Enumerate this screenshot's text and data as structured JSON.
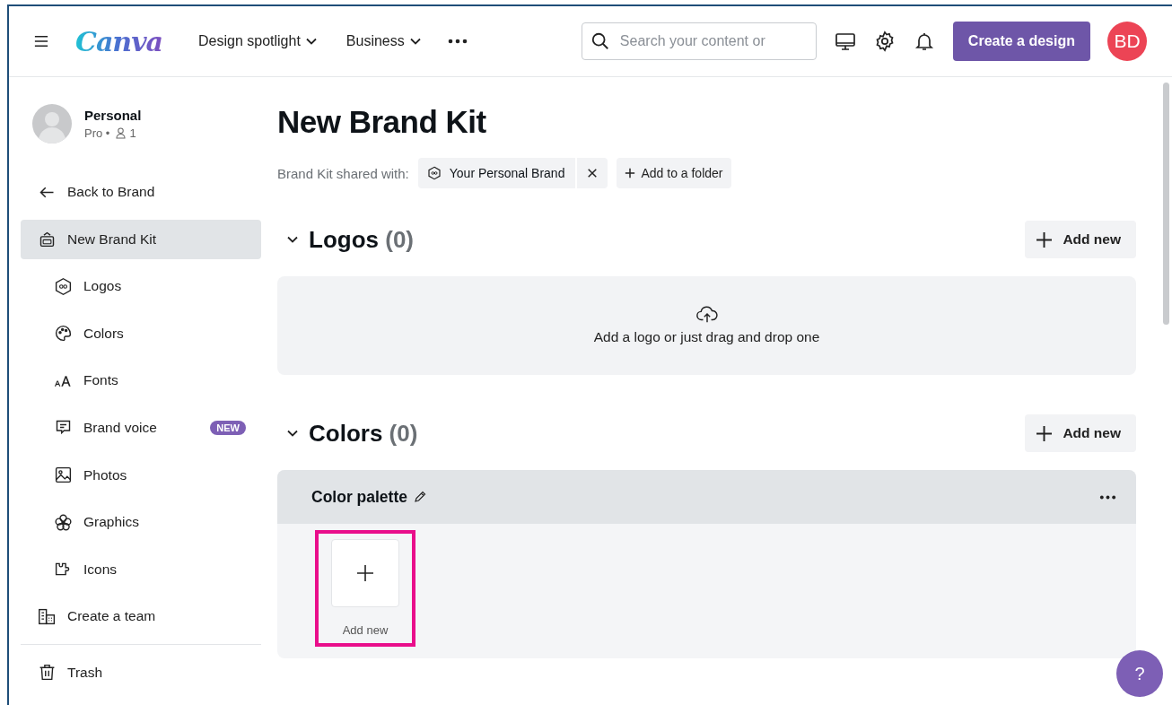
{
  "header": {
    "logo": "Canva",
    "nav": [
      {
        "label": "Design spotlight",
        "dropdown": true
      },
      {
        "label": "Business",
        "dropdown": true
      }
    ],
    "search": {
      "placeholder": "Search your content or"
    },
    "create_button": "Create a design",
    "avatar": "BD"
  },
  "sidebar": {
    "account": {
      "name": "Personal",
      "plan": "Pro •",
      "members": "1"
    },
    "back": "Back to Brand",
    "items": [
      {
        "label": "New Brand Kit",
        "kind": "kit",
        "selected": true,
        "children": [
          {
            "label": "Logos",
            "kind": "logo",
            "selected": false
          },
          {
            "label": "Colors",
            "kind": "palette",
            "selected": false
          },
          {
            "label": "Fonts",
            "kind": "fonts",
            "selected": false
          },
          {
            "label": "Brand voice",
            "kind": "voice",
            "selected": false,
            "badge": "NEW"
          },
          {
            "label": "Photos",
            "kind": "photo",
            "selected": false
          },
          {
            "label": "Graphics",
            "kind": "flower",
            "selected": false
          },
          {
            "label": "Icons",
            "kind": "puzzle",
            "selected": false
          }
        ]
      },
      {
        "label": "Create a team",
        "kind": "team",
        "selected": false
      }
    ],
    "footer_items": [
      {
        "label": "Trash",
        "kind": "trash",
        "selected": false
      }
    ]
  },
  "main": {
    "title": "New Brand Kit",
    "shared_label": "Brand Kit shared with:",
    "shared_chip": "Your Personal Brand",
    "add_folder": "Add to a folder",
    "sections": [
      {
        "kind": "logos",
        "title": "Logos",
        "count": "(0)",
        "expanded": true,
        "add_button": "Add new",
        "dropzone": "Add a logo or just drag and drop one"
      },
      {
        "kind": "colors",
        "title": "Colors",
        "count": "(0)",
        "expanded": true,
        "add_button": "Add new",
        "palette": {
          "title": "Color palette",
          "add_tile": "Add new",
          "highlighted": true
        }
      }
    ]
  },
  "help_button": "?"
}
